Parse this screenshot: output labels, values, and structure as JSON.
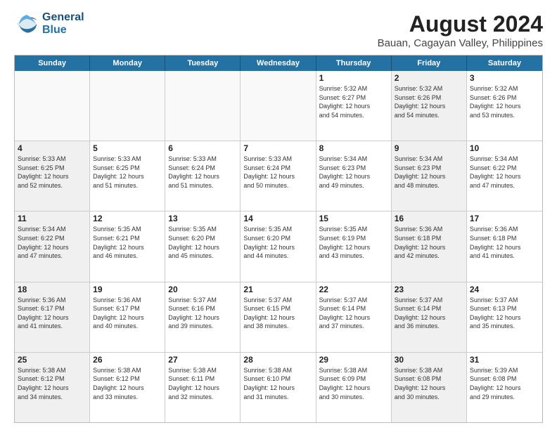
{
  "logo": {
    "line1": "General",
    "line2": "Blue"
  },
  "title": "August 2024",
  "subtitle": "Bauan, Cagayan Valley, Philippines",
  "header": {
    "days": [
      "Sunday",
      "Monday",
      "Tuesday",
      "Wednesday",
      "Thursday",
      "Friday",
      "Saturday"
    ]
  },
  "weeks": [
    {
      "cells": [
        {
          "day": "",
          "empty": true
        },
        {
          "day": "",
          "empty": true
        },
        {
          "day": "",
          "empty": true
        },
        {
          "day": "",
          "empty": true
        },
        {
          "day": "1",
          "info": "Sunrise: 5:32 AM\nSunset: 6:27 PM\nDaylight: 12 hours\nand 54 minutes.",
          "shade": false
        },
        {
          "day": "2",
          "info": "Sunrise: 5:32 AM\nSunset: 6:26 PM\nDaylight: 12 hours\nand 54 minutes.",
          "shade": true
        },
        {
          "day": "3",
          "info": "Sunrise: 5:32 AM\nSunset: 6:26 PM\nDaylight: 12 hours\nand 53 minutes.",
          "shade": false
        }
      ]
    },
    {
      "cells": [
        {
          "day": "4",
          "info": "Sunrise: 5:33 AM\nSunset: 6:25 PM\nDaylight: 12 hours\nand 52 minutes.",
          "shade": true
        },
        {
          "day": "5",
          "info": "Sunrise: 5:33 AM\nSunset: 6:25 PM\nDaylight: 12 hours\nand 51 minutes.",
          "shade": false
        },
        {
          "day": "6",
          "info": "Sunrise: 5:33 AM\nSunset: 6:24 PM\nDaylight: 12 hours\nand 51 minutes.",
          "shade": false
        },
        {
          "day": "7",
          "info": "Sunrise: 5:33 AM\nSunset: 6:24 PM\nDaylight: 12 hours\nand 50 minutes.",
          "shade": false
        },
        {
          "day": "8",
          "info": "Sunrise: 5:34 AM\nSunset: 6:23 PM\nDaylight: 12 hours\nand 49 minutes.",
          "shade": false
        },
        {
          "day": "9",
          "info": "Sunrise: 5:34 AM\nSunset: 6:23 PM\nDaylight: 12 hours\nand 48 minutes.",
          "shade": true
        },
        {
          "day": "10",
          "info": "Sunrise: 5:34 AM\nSunset: 6:22 PM\nDaylight: 12 hours\nand 47 minutes.",
          "shade": false
        }
      ]
    },
    {
      "cells": [
        {
          "day": "11",
          "info": "Sunrise: 5:34 AM\nSunset: 6:22 PM\nDaylight: 12 hours\nand 47 minutes.",
          "shade": true
        },
        {
          "day": "12",
          "info": "Sunrise: 5:35 AM\nSunset: 6:21 PM\nDaylight: 12 hours\nand 46 minutes.",
          "shade": false
        },
        {
          "day": "13",
          "info": "Sunrise: 5:35 AM\nSunset: 6:20 PM\nDaylight: 12 hours\nand 45 minutes.",
          "shade": false
        },
        {
          "day": "14",
          "info": "Sunrise: 5:35 AM\nSunset: 6:20 PM\nDaylight: 12 hours\nand 44 minutes.",
          "shade": false
        },
        {
          "day": "15",
          "info": "Sunrise: 5:35 AM\nSunset: 6:19 PM\nDaylight: 12 hours\nand 43 minutes.",
          "shade": false
        },
        {
          "day": "16",
          "info": "Sunrise: 5:36 AM\nSunset: 6:18 PM\nDaylight: 12 hours\nand 42 minutes.",
          "shade": true
        },
        {
          "day": "17",
          "info": "Sunrise: 5:36 AM\nSunset: 6:18 PM\nDaylight: 12 hours\nand 41 minutes.",
          "shade": false
        }
      ]
    },
    {
      "cells": [
        {
          "day": "18",
          "info": "Sunrise: 5:36 AM\nSunset: 6:17 PM\nDaylight: 12 hours\nand 41 minutes.",
          "shade": true
        },
        {
          "day": "19",
          "info": "Sunrise: 5:36 AM\nSunset: 6:17 PM\nDaylight: 12 hours\nand 40 minutes.",
          "shade": false
        },
        {
          "day": "20",
          "info": "Sunrise: 5:37 AM\nSunset: 6:16 PM\nDaylight: 12 hours\nand 39 minutes.",
          "shade": false
        },
        {
          "day": "21",
          "info": "Sunrise: 5:37 AM\nSunset: 6:15 PM\nDaylight: 12 hours\nand 38 minutes.",
          "shade": false
        },
        {
          "day": "22",
          "info": "Sunrise: 5:37 AM\nSunset: 6:14 PM\nDaylight: 12 hours\nand 37 minutes.",
          "shade": false
        },
        {
          "day": "23",
          "info": "Sunrise: 5:37 AM\nSunset: 6:14 PM\nDaylight: 12 hours\nand 36 minutes.",
          "shade": true
        },
        {
          "day": "24",
          "info": "Sunrise: 5:37 AM\nSunset: 6:13 PM\nDaylight: 12 hours\nand 35 minutes.",
          "shade": false
        }
      ]
    },
    {
      "cells": [
        {
          "day": "25",
          "info": "Sunrise: 5:38 AM\nSunset: 6:12 PM\nDaylight: 12 hours\nand 34 minutes.",
          "shade": true
        },
        {
          "day": "26",
          "info": "Sunrise: 5:38 AM\nSunset: 6:12 PM\nDaylight: 12 hours\nand 33 minutes.",
          "shade": false
        },
        {
          "day": "27",
          "info": "Sunrise: 5:38 AM\nSunset: 6:11 PM\nDaylight: 12 hours\nand 32 minutes.",
          "shade": false
        },
        {
          "day": "28",
          "info": "Sunrise: 5:38 AM\nSunset: 6:10 PM\nDaylight: 12 hours\nand 31 minutes.",
          "shade": false
        },
        {
          "day": "29",
          "info": "Sunrise: 5:38 AM\nSunset: 6:09 PM\nDaylight: 12 hours\nand 30 minutes.",
          "shade": false
        },
        {
          "day": "30",
          "info": "Sunrise: 5:38 AM\nSunset: 6:08 PM\nDaylight: 12 hours\nand 30 minutes.",
          "shade": true
        },
        {
          "day": "31",
          "info": "Sunrise: 5:39 AM\nSunset: 6:08 PM\nDaylight: 12 hours\nand 29 minutes.",
          "shade": false
        }
      ]
    }
  ]
}
